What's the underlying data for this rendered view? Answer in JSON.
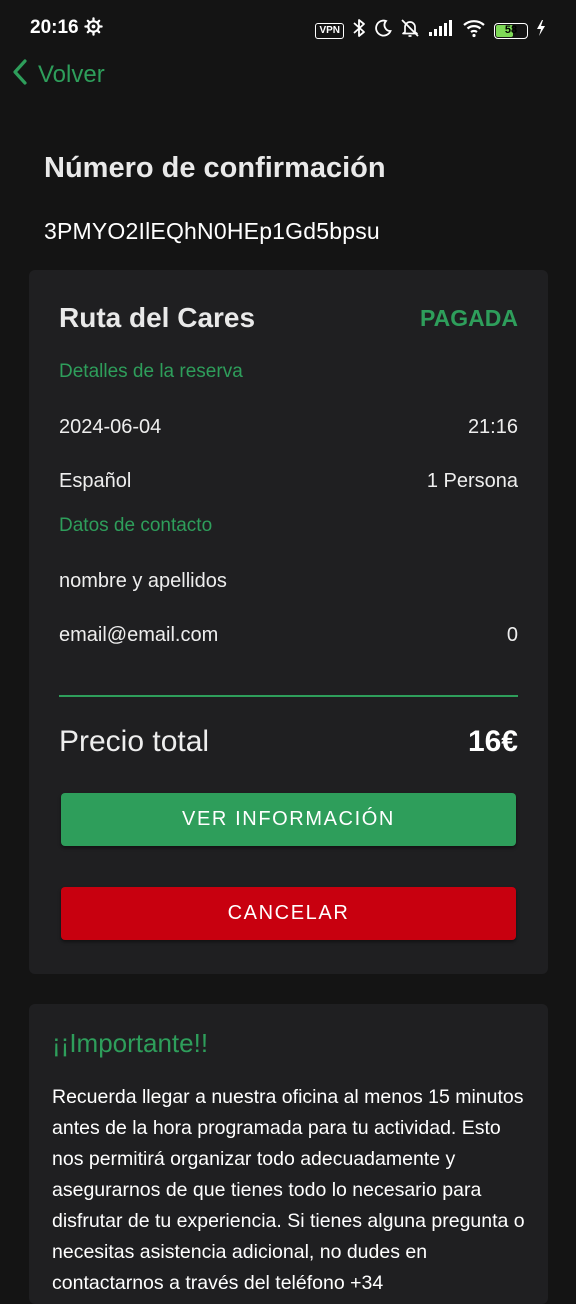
{
  "status_bar": {
    "time": "20:16",
    "vpn_label": "VPN",
    "battery_level": "58",
    "battery_fraction": 0.58,
    "icons": [
      "gear-icon",
      "bluetooth-icon",
      "moon-icon",
      "bell-off-icon",
      "signal-icon",
      "wifi-icon",
      "battery-icon",
      "charging-icon"
    ]
  },
  "nav": {
    "back_label": "Volver"
  },
  "confirmation": {
    "title": "Número de confirmación",
    "code": "3PMYO2IlEQhN0HEp1Gd5bpsu"
  },
  "booking": {
    "tour_name": "Ruta del Cares",
    "status": "PAGADA",
    "details_heading": "Detalles de la reserva",
    "date": "2024-06-04",
    "time": "21:16",
    "language": "Español",
    "people": "1 Persona",
    "contact_heading": "Datos de contacto",
    "contact_name": "nombre y apellidos",
    "contact_email": "email@email.com",
    "contact_phone": "0",
    "total_label": "Precio total",
    "total_value": "16€",
    "info_button": "VER INFORMACIÓN",
    "cancel_button": "CANCELAR"
  },
  "important": {
    "title": "¡¡Importante!!",
    "text": "Recuerda llegar a nuestra oficina al menos 15 minutos antes de la hora programada para tu actividad. Esto nos permitirá organizar todo adecuadamente y asegurarnos de que tienes todo lo necesario para disfrutar de tu experiencia. Si tienes alguna pregunta o necesitas asistencia adicional, no dudes en contactarnos a través del teléfono +34"
  },
  "colors": {
    "accent": "#2e9e5b",
    "danger": "#c8000f",
    "background": "#141414",
    "card": "#1f1f21"
  }
}
